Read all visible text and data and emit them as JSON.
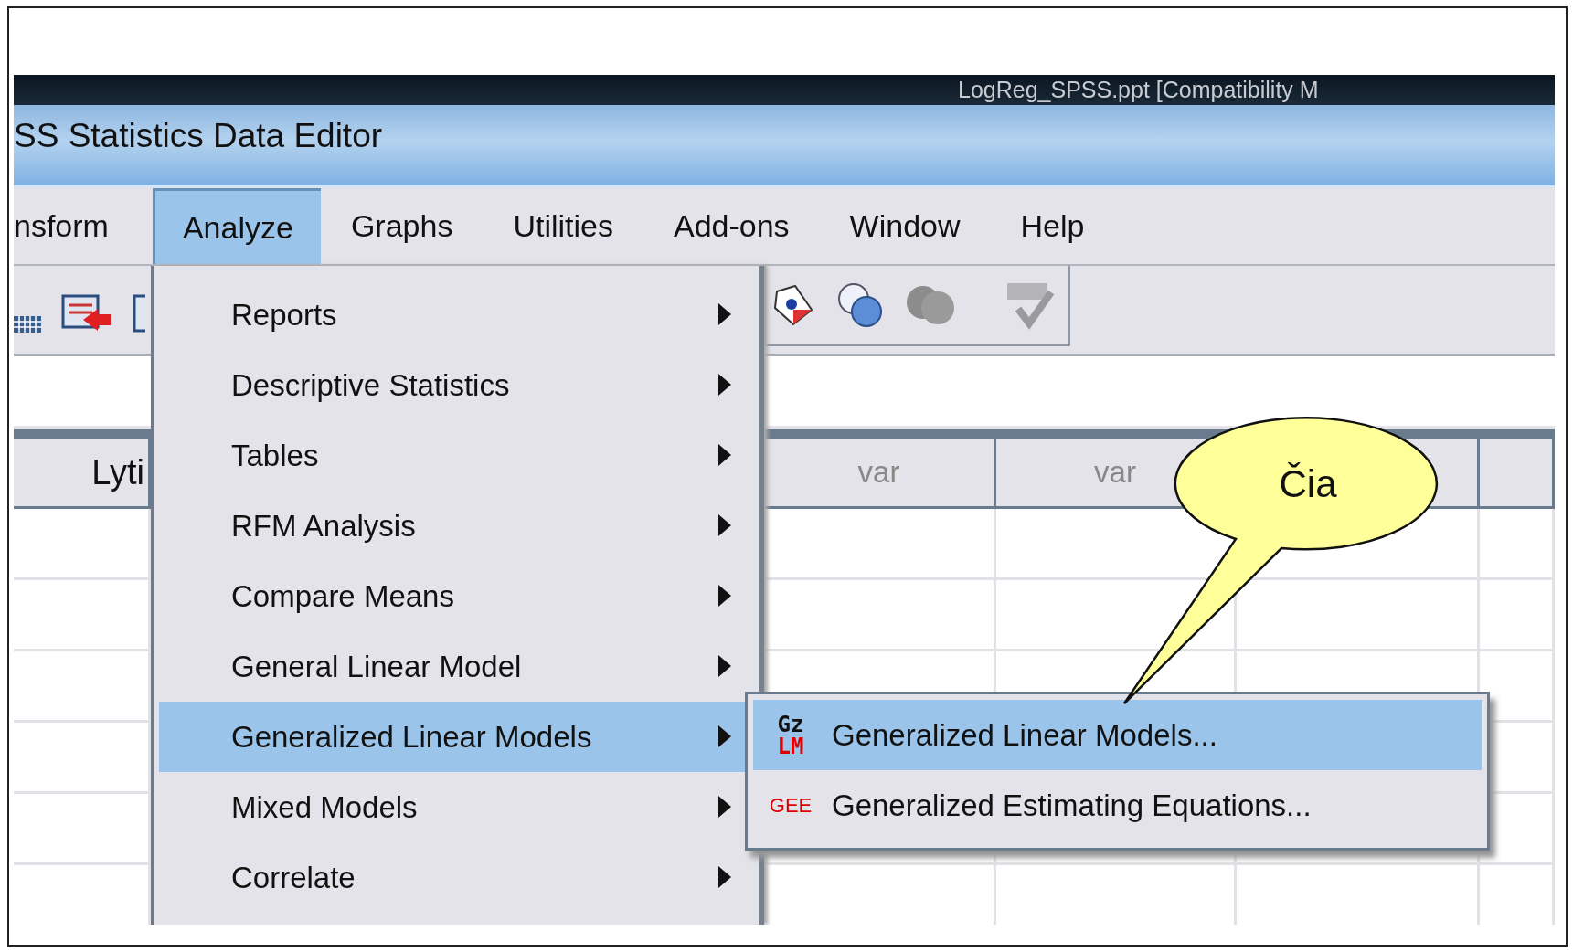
{
  "document_title": "LogReg_SPSS.ppt [Compatibility M",
  "window": {
    "title": "SS Statistics Data Editor"
  },
  "menu_bar": [
    {
      "label": "nsform",
      "selected": false
    },
    {
      "label": "Analyze",
      "selected": true
    },
    {
      "label": "Graphs",
      "selected": false
    },
    {
      "label": "Utilities",
      "selected": false
    },
    {
      "label": "Add-ons",
      "selected": false
    },
    {
      "label": "Window",
      "selected": false
    },
    {
      "label": "Help",
      "selected": false
    }
  ],
  "table": {
    "columns": [
      "Lyti",
      "var",
      "var"
    ]
  },
  "analyze_menu": [
    {
      "label": "Reports",
      "submenu": true,
      "selected": false
    },
    {
      "label": "Descriptive Statistics",
      "submenu": true,
      "selected": false
    },
    {
      "label": "Tables",
      "submenu": true,
      "selected": false
    },
    {
      "label": "RFM Analysis",
      "submenu": true,
      "selected": false
    },
    {
      "label": "Compare Means",
      "submenu": true,
      "selected": false
    },
    {
      "label": "General Linear Model",
      "submenu": true,
      "selected": false
    },
    {
      "label": "Generalized Linear Models",
      "submenu": true,
      "selected": true
    },
    {
      "label": "Mixed Models",
      "submenu": true,
      "selected": false
    },
    {
      "label": "Correlate",
      "submenu": true,
      "selected": false
    }
  ],
  "submenu": [
    {
      "label": "Generalized Linear Models...",
      "icon_text": [
        "Gz",
        "LM"
      ],
      "selected": true
    },
    {
      "label": "Generalized Estimating Equations...",
      "icon_text": [
        "GEE"
      ],
      "selected": false
    }
  ],
  "callout": {
    "text": "Čia"
  }
}
